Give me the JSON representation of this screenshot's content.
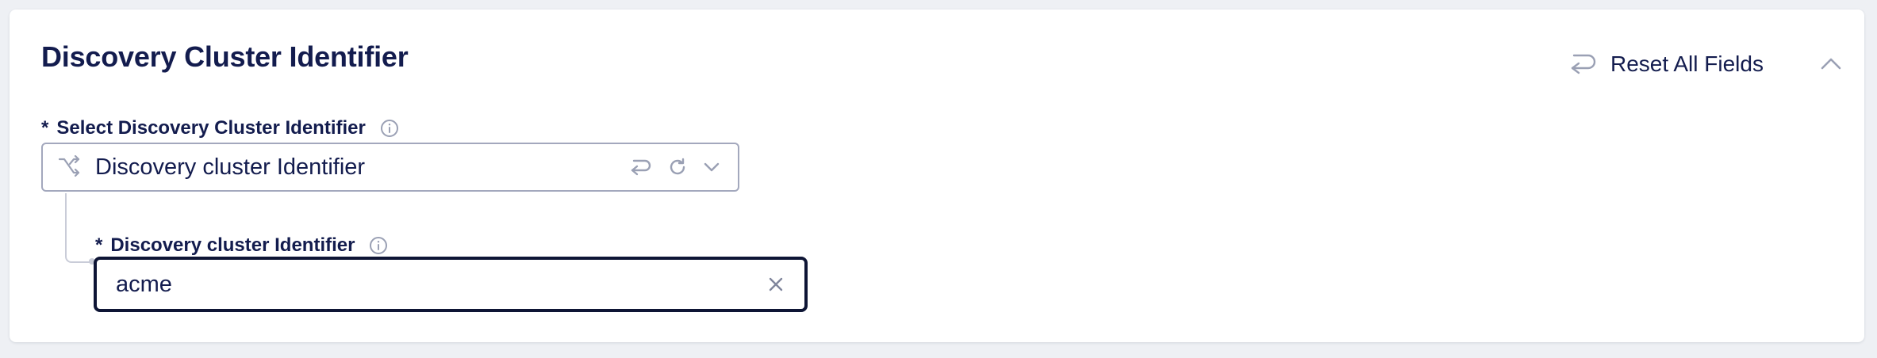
{
  "section": {
    "title": "Discovery Cluster Identifier",
    "reset_label": "Reset All Fields",
    "collapse_icon": "chevron-up-icon"
  },
  "select_field": {
    "required_marker": "*",
    "label": "Select Discovery Cluster Identifier",
    "info_icon": "info-icon",
    "lead_icon": "merge-arrows-icon",
    "value": "Discovery cluster Identifier",
    "action_icons": [
      "undo-icon",
      "refresh-icon",
      "chevron-down-icon"
    ]
  },
  "sub_field": {
    "required_marker": "*",
    "label": "Discovery cluster Identifier",
    "info_icon": "info-icon",
    "value": "acme",
    "clear_icon": "close-icon"
  },
  "colors": {
    "text": "#131c4e",
    "border_default": "#a3a8bd",
    "border_focus": "#0e1535",
    "icon": "#9aa0b4"
  }
}
